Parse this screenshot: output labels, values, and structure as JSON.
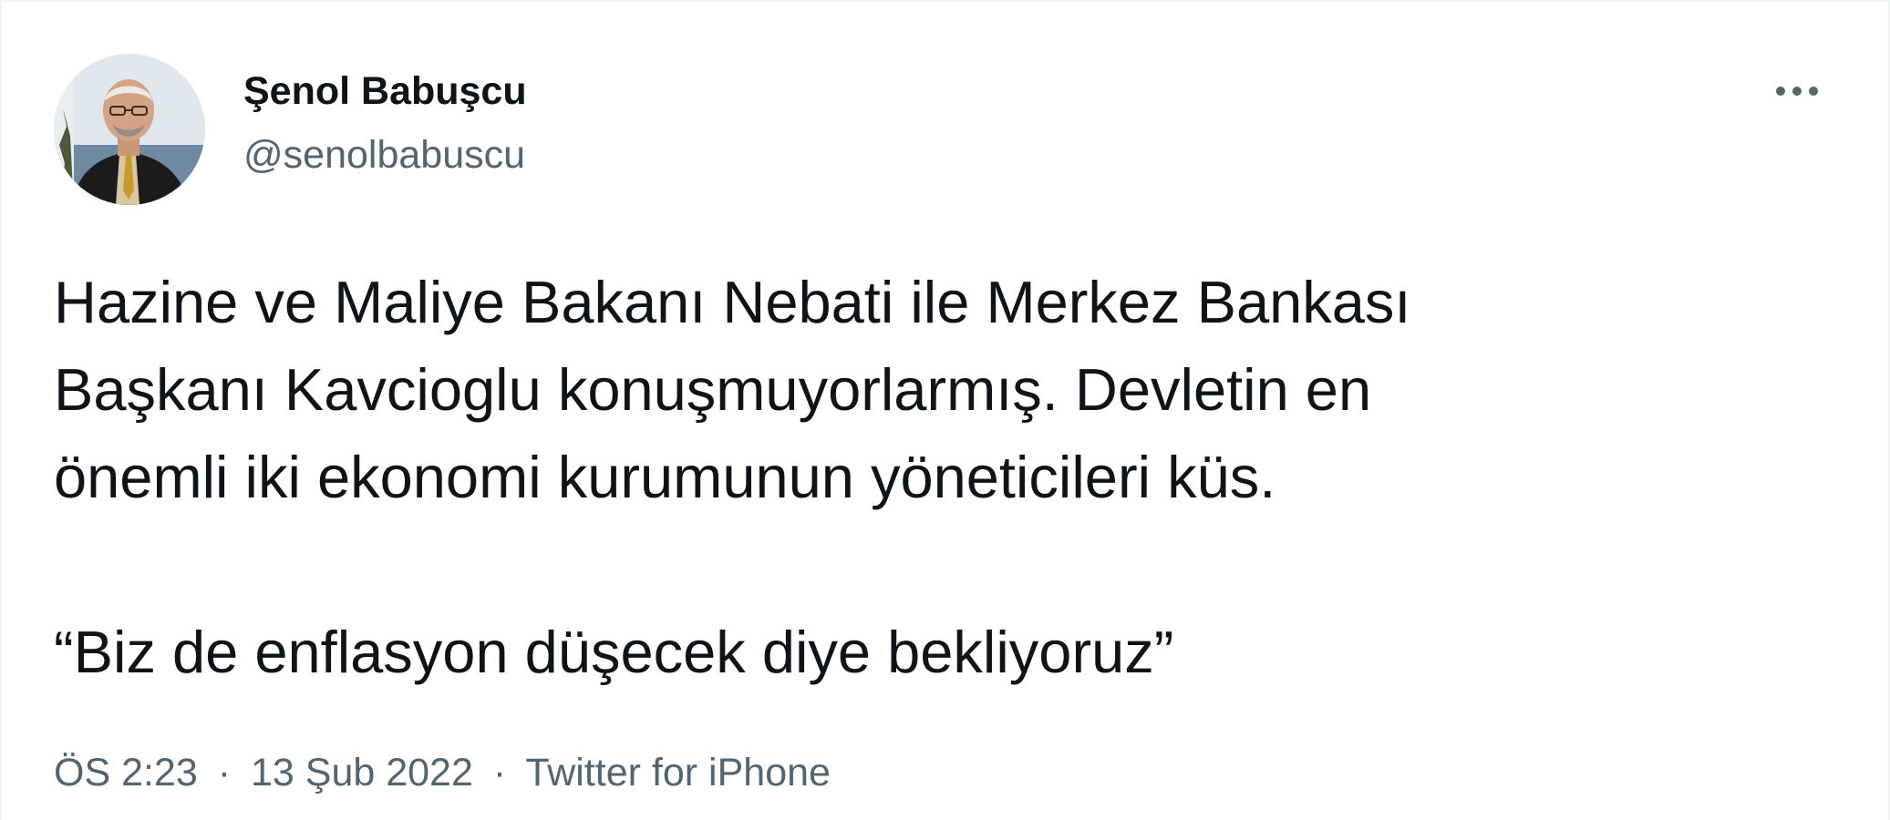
{
  "author": {
    "display_name": "Şenol Babuşcu",
    "handle": "@senolbabuscu"
  },
  "tweet": {
    "body": "Hazine ve Maliye Bakanı Nebati ile Merkez Bankası\nBaşkanı Kavcioglu konuşmuyorlarmış. Devletin en\nönemli iki ekonomi kurumunun yöneticileri küs.",
    "quote": "“Biz de enflasyon düşecek diye bekliyoruz”"
  },
  "meta": {
    "time": "ÖS 2:23",
    "date": "13 Şub 2022",
    "separator": "·",
    "source": "Twitter for iPhone"
  },
  "icons": {
    "more": "more-horizontal-icon",
    "avatar": "profile-photo"
  },
  "colors": {
    "text": "#0f1419",
    "secondary": "#536471",
    "border": "#eff3f4"
  }
}
